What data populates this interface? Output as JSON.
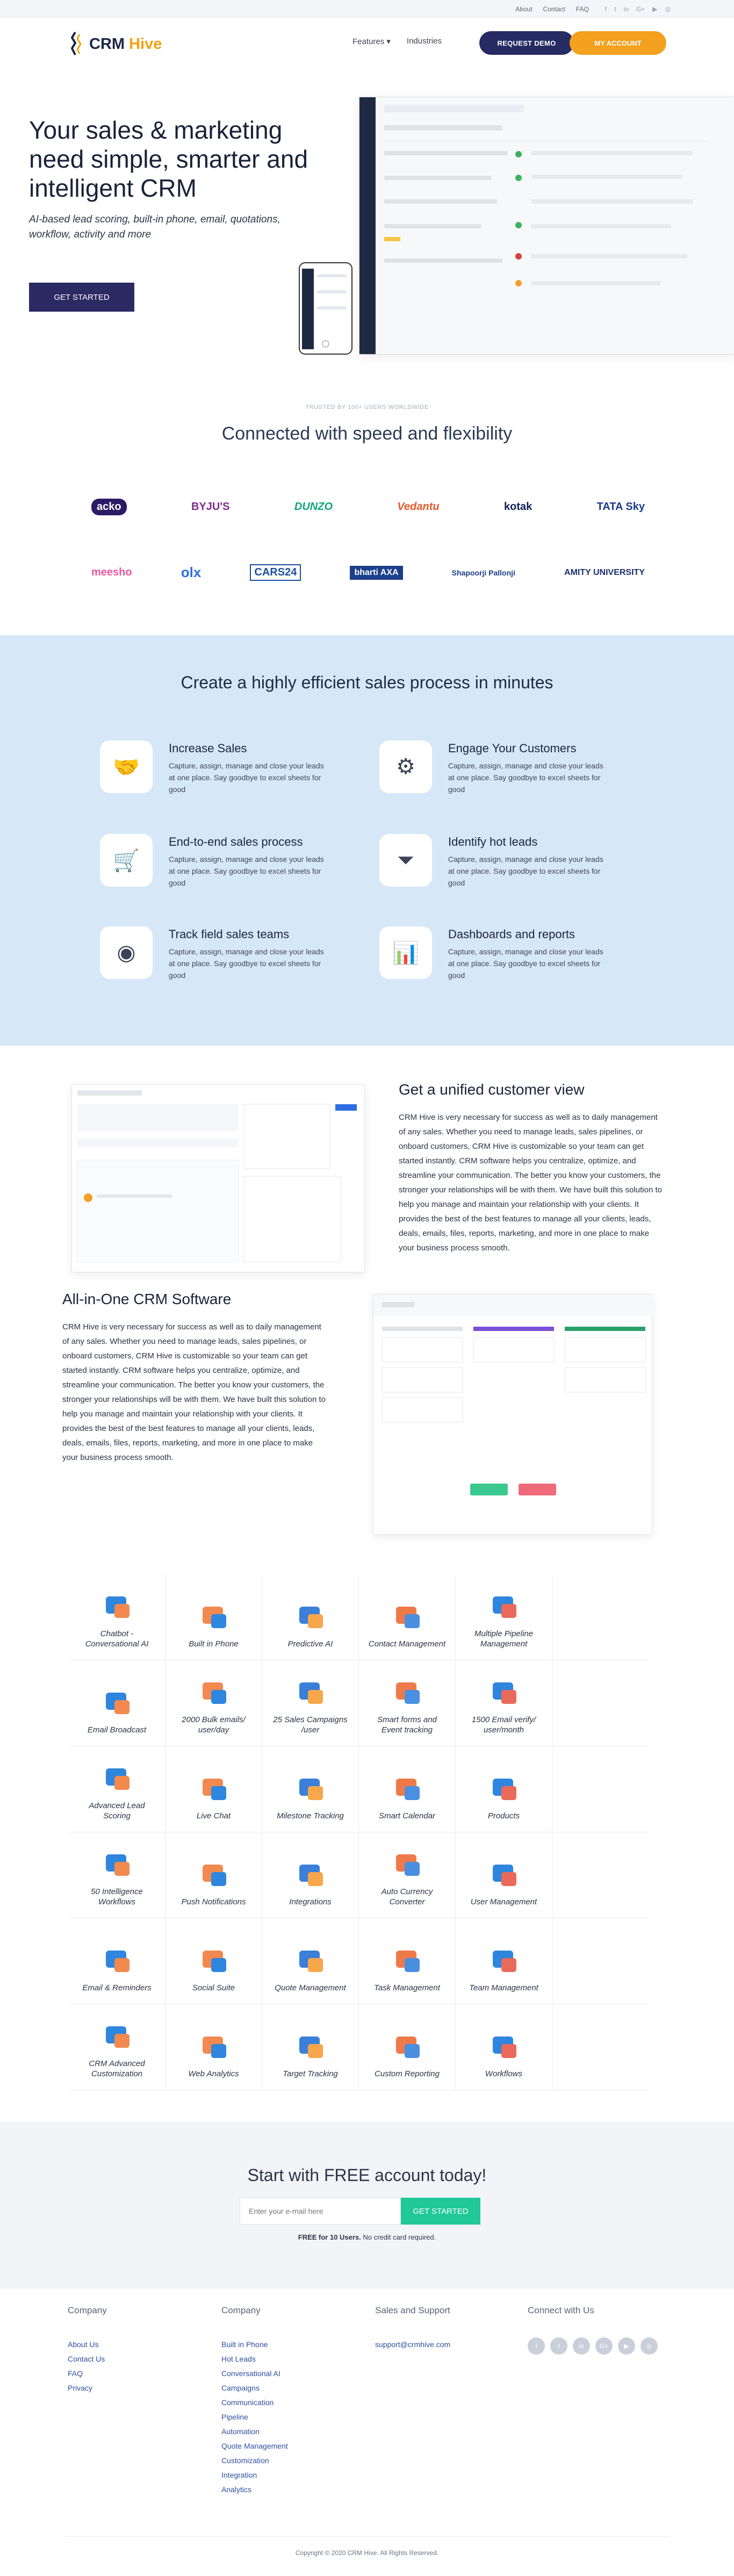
{
  "topbar": {
    "links": [
      "About",
      "Contact",
      "FAQ"
    ],
    "social": [
      "f",
      "t",
      "in",
      "G+",
      "▶",
      "◎"
    ]
  },
  "brand": {
    "name_a": "CRM ",
    "name_b": "Hive"
  },
  "nav": {
    "features": "Features ▾",
    "industries": "Industries",
    "request_demo": "REQUEST DEMO",
    "my_account": "MY ACCOUNT"
  },
  "hero": {
    "title": "Your sales & marketing need simple, smarter and intelligent CRM",
    "subtitle": "AI-based lead scoring, built-in phone, email, quotations, workflow, activity and more",
    "cta": "GET STARTED"
  },
  "trust": {
    "caption": "TRUSTED BY 100+ USERS WORLDWIDE",
    "title": "Connected with speed and flexibility"
  },
  "clients": {
    "row1": [
      "acko",
      "BYJU'S",
      "DUNZO",
      "Vedantu",
      "kotak",
      "TATA Sky"
    ],
    "row2": [
      "meesho",
      "olx",
      "CARS24",
      "bharti AXA",
      "Shapoorji Pallonji",
      "AMITY UNIVERSITY"
    ]
  },
  "process": {
    "title": "Create a highly efficient sales process in minutes",
    "features": [
      {
        "title": "Increase Sales",
        "text": "Capture, assign, manage and close your leads at one place. Say goodbye to excel sheets for good"
      },
      {
        "title": "Engage Your Customers",
        "text": "Capture, assign, manage and close your leads at one place. Say goodbye to excel sheets for good"
      },
      {
        "title": "End-to-end sales process",
        "text": "Capture, assign, manage and close your leads at one place. Say goodbye to excel sheets for good"
      },
      {
        "title": "Identify hot leads",
        "text": "Capture, assign, manage and close your leads at one place. Say goodbye to excel sheets for good"
      },
      {
        "title": "Track field sales teams",
        "text": "Capture, assign, manage and close your leads at one place. Say goodbye to excel sheets for good"
      },
      {
        "title": "Dashboards and reports",
        "text": "Capture, assign, manage and close your leads at one place. Say goodbye to excel sheets for good"
      }
    ]
  },
  "unified": {
    "title": "Get a unified customer view",
    "text": "CRM Hive is very necessary for success as well as to daily management of any sales. Whether you need to manage leads, sales pipelines, or onboard customers, CRM Hive is customizable so your team can get started instantly. CRM software helps you centralize, optimize, and streamline your communication. The better you know your customers, the stronger your relationships will be with them. We have built this solution to help you manage and maintain your relationship with your clients. It provides the best of the best features to manage all your clients, leads, deals, emails, files, reports, marketing, and more in one place to make your business process smooth."
  },
  "allinone": {
    "title": "All-in-One CRM Software",
    "text": "CRM Hive is very necessary for success as well as to daily management of any sales. Whether you need to manage leads, sales pipelines, or onboard customers, CRM Hive is customizable so your team can get started instantly. CRM software helps you centralize, optimize, and streamline your communication. The better you know your customers, the stronger your relationships will be with them. We have built this solution to help you manage and maintain your relationship with your clients. It provides the best of the best features to manage all your clients, leads, deals, emails, files, reports, marketing, and more in one place to make your business process smooth."
  },
  "grid": [
    "Chatbot - Conversational AI",
    "Built in Phone",
    "Predictive AI",
    "Contact Management",
    "Multiple Pipeline Management",
    "",
    "Email Broadcast",
    "2000 Bulk emails/ user/day",
    "25 Sales Campaigns /user",
    "Smart forms and Event tracking",
    "1500 Email verify/ user/month",
    "",
    "Advanced Lead Scoring",
    "Live Chat",
    "Milestone Tracking",
    "Smart Calendar",
    "Products",
    "",
    "50 Intelligence Workflows",
    "Push Notifications",
    "Integrations",
    "Auto Currency Converter",
    "User Management",
    "",
    "Email & Reminders",
    "Social Suite",
    "Quote Management",
    "Task Management",
    "Team Management",
    "",
    "CRM Advanced Customization",
    "Web Analytics",
    "Target Tracking",
    "Custom Reporting",
    "Workflows",
    ""
  ],
  "cta": {
    "title": "Start with FREE account today!",
    "placeholder": "Enter your e-mail here",
    "button": "GET STARTED",
    "note_bold": "FREE for 10 Users.",
    "note": " No credit card required."
  },
  "footer": {
    "col1": {
      "title": "Company",
      "links": [
        "About Us",
        "Contact Us",
        "FAQ",
        "Privacy"
      ]
    },
    "col2": {
      "title": "Company",
      "links": [
        "Built in Phone",
        "Hot Leads",
        "Conversational AI",
        "Campaigns",
        "Communication",
        "Pipeline",
        "Automation",
        "Quote Management",
        "Customization",
        "Integration",
        "Analytics"
      ]
    },
    "col3": {
      "title": "Sales and Support",
      "email": "support@crmhive.com"
    },
    "col4": {
      "title": "Connect with Us",
      "social": [
        "f",
        "t",
        "in",
        "G+",
        "▶",
        "◎"
      ]
    },
    "copyright": "Copyright © 2020 CRM Hive. All Rights Reserved."
  }
}
